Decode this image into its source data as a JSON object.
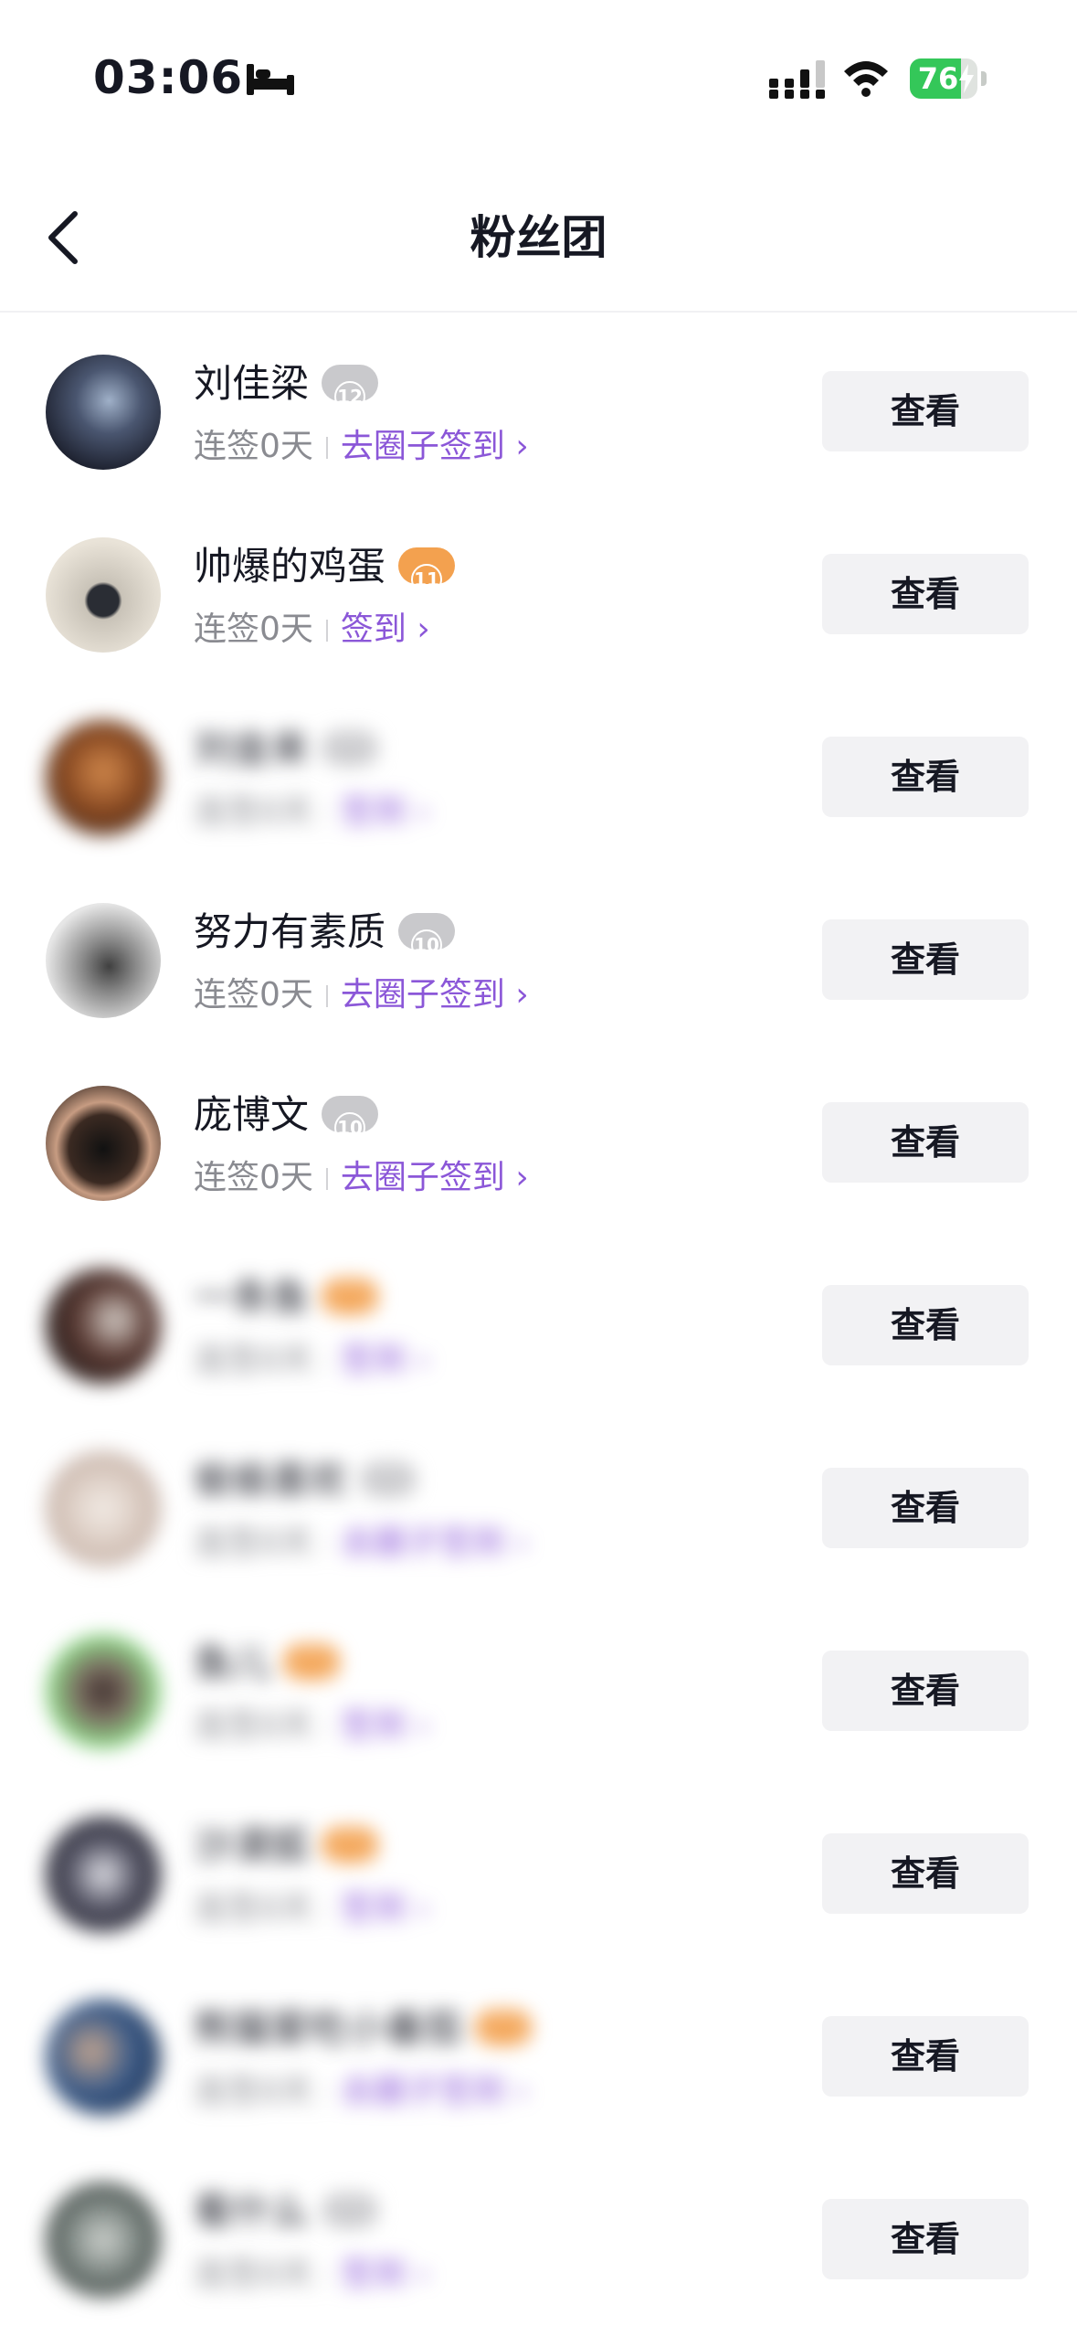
{
  "status_bar": {
    "time": "03:06",
    "battery": "76",
    "battery_level": 0.76
  },
  "header": {
    "title": "粉丝团"
  },
  "rows": [
    {
      "name": "刘佳梁",
      "level": "12",
      "badge_color": "gray",
      "streak": "连签0天",
      "action": "去圈子签到",
      "button": "查看"
    },
    {
      "name": "帅爆的鸡蛋",
      "level": "11",
      "badge_color": "orange",
      "streak": "连签0天",
      "action": "签到",
      "button": "查看"
    },
    {
      "name": "刘金来",
      "level": "",
      "badge_color": "gray",
      "streak": "连签0天",
      "action": "签到",
      "button": "查看"
    },
    {
      "name": "努力有素质",
      "level": "10",
      "badge_color": "gray",
      "streak": "连签0天",
      "action": "去圈子签到",
      "button": "查看"
    },
    {
      "name": "庞博文",
      "level": "10",
      "badge_color": "gray",
      "streak": "连签0天",
      "action": "去圈子签到",
      "button": "查看"
    },
    {
      "name": "一条鱼",
      "level": "",
      "badge_color": "orange",
      "streak": "连签0天",
      "action": "签到",
      "button": "查看"
    },
    {
      "name": "偷偷喜欢",
      "level": "",
      "badge_color": "gray",
      "streak": "连签0天",
      "action": "去圈子签到",
      "button": "查看"
    },
    {
      "name": "鱼儿",
      "level": "",
      "badge_color": "orange",
      "streak": "连签0天",
      "action": "签到",
      "button": "查看"
    },
    {
      "name": "沙漠狐",
      "level": "",
      "badge_color": "orange",
      "streak": "连签0天",
      "action": "签到",
      "button": "查看"
    },
    {
      "name": "熊猫爱吃小番茄",
      "level": "",
      "badge_color": "orange",
      "streak": "连签0天",
      "action": "去圈子签到",
      "button": "查看"
    },
    {
      "name": "看什么",
      "level": "",
      "badge_color": "gray",
      "streak": "连签0天",
      "action": "签到",
      "button": "查看"
    }
  ]
}
